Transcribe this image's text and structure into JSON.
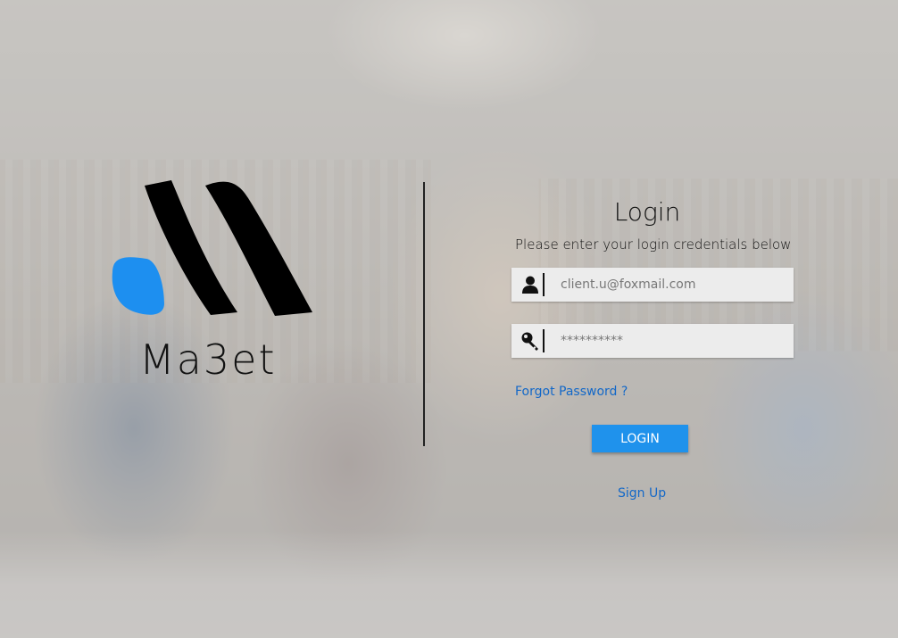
{
  "brand": {
    "name": "Ma3et",
    "logo_icon": "ma3et-logo-icon",
    "colors": {
      "drop": "#1d8ff0",
      "mark": "#000000"
    }
  },
  "login": {
    "title": "Login",
    "subtitle": "Please enter your login credentials below",
    "email": {
      "icon": "user-icon",
      "placeholder": "client.u@foxmail.com",
      "value": ""
    },
    "password": {
      "icon": "key-icon",
      "placeholder": "**********",
      "value": ""
    },
    "forgot_label": "Forgot Password ?",
    "submit_label": "LOGIN",
    "signup_label": "Sign Up"
  },
  "colors": {
    "accent": "#1f92ec",
    "link": "#1368c8"
  }
}
